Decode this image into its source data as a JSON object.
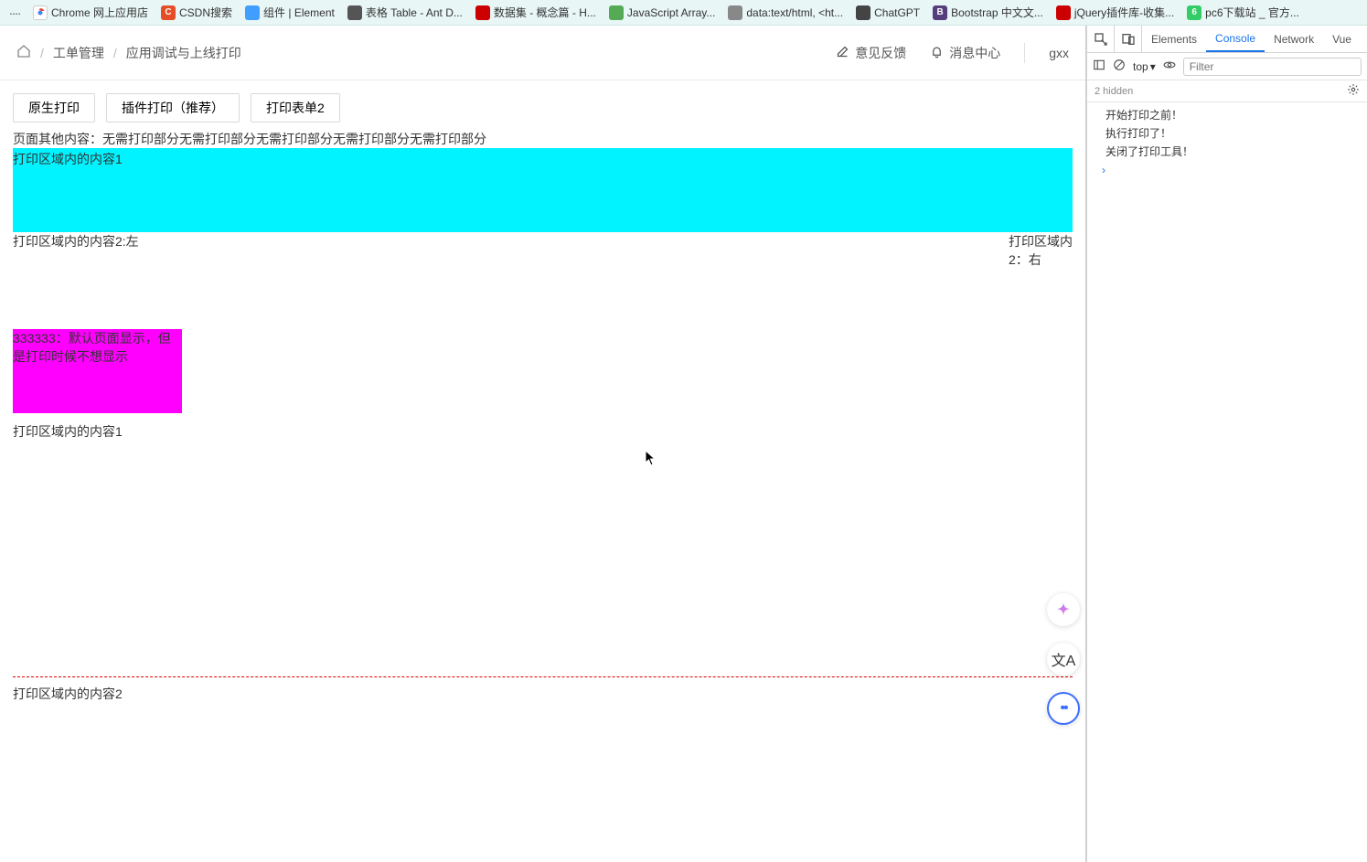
{
  "bookmarks": [
    {
      "label": "Chrome 网上应用店",
      "color": "#f5f5f5"
    },
    {
      "label": "CSDN搜索",
      "color": "#e44d26",
      "letter": "C"
    },
    {
      "label": "组件 | Element",
      "color": "#409eff",
      "letter": ""
    },
    {
      "label": "表格 Table - Ant D...",
      "color": "#666",
      "letter": ""
    },
    {
      "label": "数据集 - 概念篇 - H...",
      "color": "#c00",
      "letter": ""
    },
    {
      "label": "JavaScript Array...",
      "color": "#5a5",
      "letter": ""
    },
    {
      "label": "data:text/html, <ht...",
      "color": "#888",
      "letter": ""
    },
    {
      "label": "ChatGPT",
      "color": "#555",
      "letter": ""
    },
    {
      "label": "Bootstrap 中文文...",
      "color": "#563d7c",
      "letter": "B"
    },
    {
      "label": "jQuery插件库-收集...",
      "color": "#c00",
      "letter": ""
    },
    {
      "label": "pc6下载站 _ 官方...",
      "color": "#3c6",
      "letter": "6"
    }
  ],
  "breadcrumb": {
    "item1": "工单管理",
    "item2": "应用调试与上线打印",
    "sep": "/"
  },
  "header": {
    "feedback": "意见反馈",
    "notice": "消息中心",
    "user": "gxx"
  },
  "tabs": {
    "t1": "原生打印",
    "t2": "插件打印（推荐）",
    "t3": "打印表单2"
  },
  "body": {
    "other": "页面其他内容：无需打印部分无需打印部分无需打印部分无需打印部分无需打印部分",
    "cyan": "打印区域内的内容1",
    "left": "打印区域内的内容2:左",
    "right": "打印区域内2：右",
    "magenta": "333333：默认页面显示，但是打印时候不想显示",
    "c1": "打印区域内的内容1",
    "c2": "打印区域内的内容2"
  },
  "devtools": {
    "tabs": {
      "elements": "Elements",
      "console": "Console",
      "network": "Network",
      "vue": "Vue"
    },
    "context": "top",
    "filter_placeholder": "Filter",
    "hidden": "2 hidden",
    "logs": [
      "开始打印之前！",
      "执行打印了！",
      "关闭了打印工具！"
    ]
  }
}
